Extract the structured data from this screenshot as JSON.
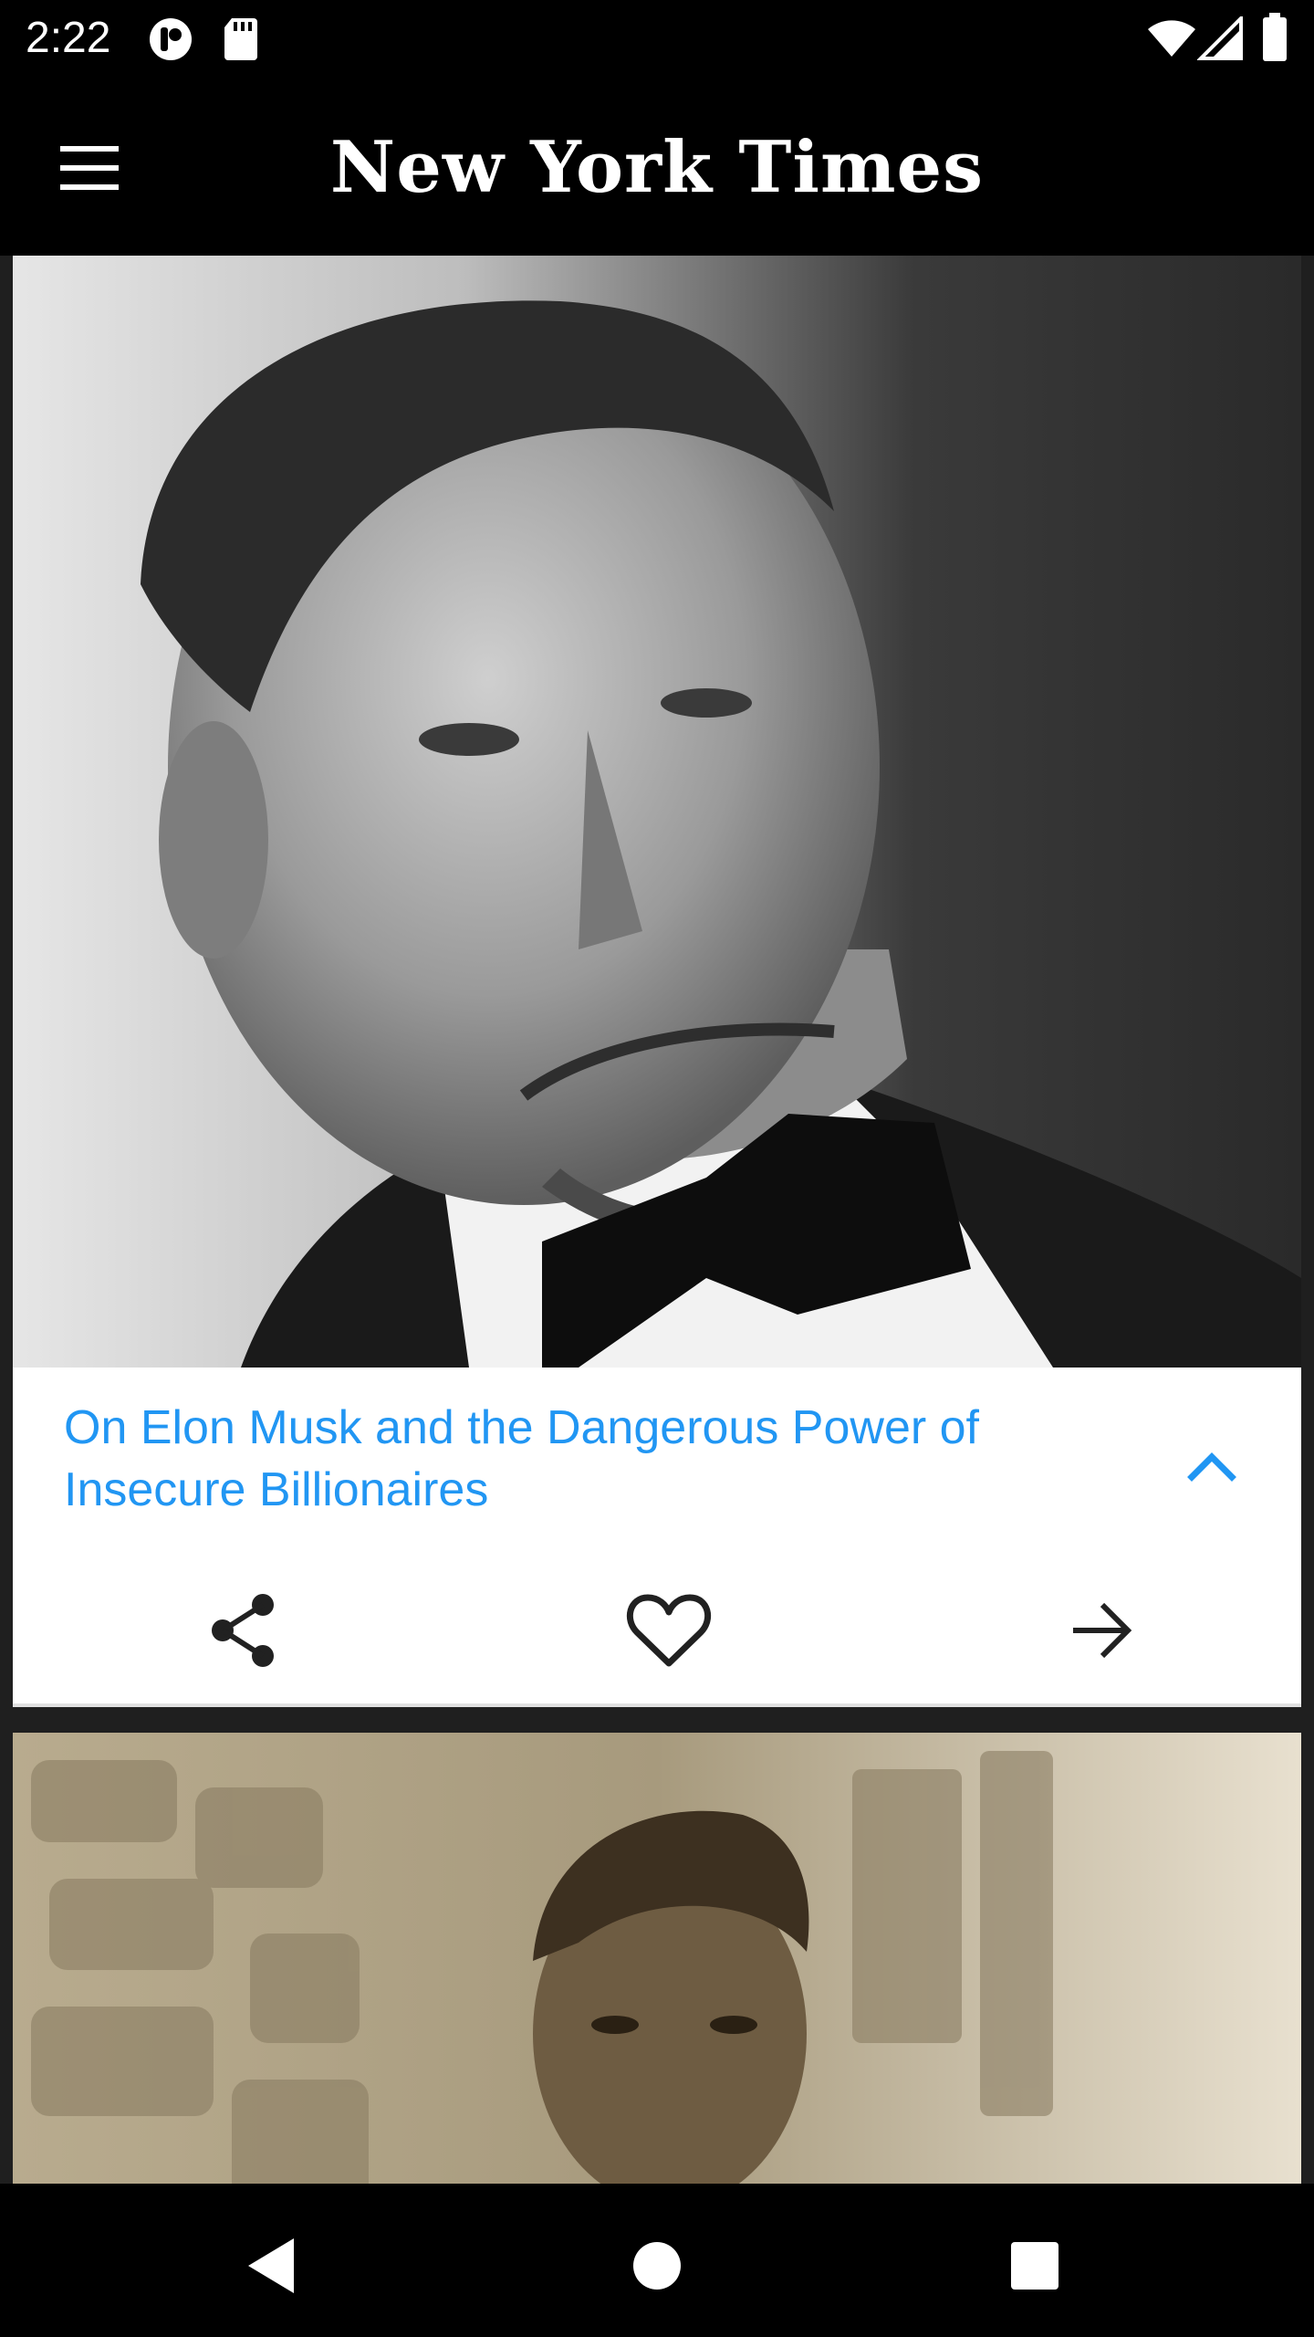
{
  "status_bar": {
    "time": "2:22",
    "icons": [
      "notification-app-icon",
      "sd-card-icon",
      "wifi-icon",
      "cellular-signal-icon",
      "battery-icon"
    ]
  },
  "app_bar": {
    "title": "New York Times",
    "menu_icon": "hamburger-menu-icon"
  },
  "feed": {
    "articles": [
      {
        "image": "portrait of Elon Musk in black-and-white, wearing tuxedo and bow tie",
        "headline": "On Elon Musk and the Dangerous Power of Insecure Billionaires",
        "expanded": true,
        "actions": [
          {
            "icon": "share-icon"
          },
          {
            "icon": "heart-icon"
          },
          {
            "icon": "arrow-right-icon"
          }
        ]
      },
      {
        "image": "sepia portrait of a man in front of a stone wall"
      }
    ]
  },
  "nav_bar": {
    "buttons": [
      {
        "icon": "back-triangle-icon"
      },
      {
        "icon": "home-circle-icon"
      },
      {
        "icon": "recents-square-icon"
      }
    ]
  },
  "colors": {
    "accent": "#2196f3",
    "background": "#000000",
    "card": "#ffffff"
  }
}
